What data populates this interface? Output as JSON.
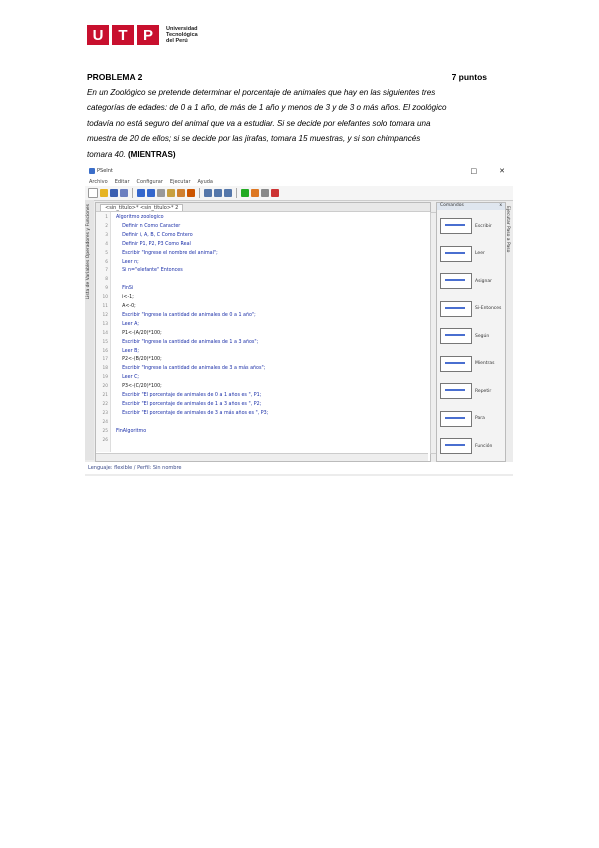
{
  "logo": {
    "letters": [
      "U",
      "T",
      "P"
    ],
    "text": [
      "Universidad",
      "Tecnológica",
      "del Perú"
    ],
    "color": "#c8102e"
  },
  "problem": {
    "title": "PROBLEMA 2",
    "points": "7 puntos"
  },
  "statement": {
    "lines": [
      "En un Zoológico se pretende determinar el porcentaje de animales que hay en las siguientes tres",
      "categorías de edades: de 0 a 1 año, de más de 1 año y menos de 3 y de 3 o más años. El zoológico",
      "todavía no está seguro del animal que va a estudiar. Si se decide por elefantes solo tomara una",
      "muestra de 20 de ellos; si se decide por las jirafas, tomara 15 muestras, y si son chimpancés"
    ],
    "last": "tomara 40.",
    "tag": "(MIENTRAS)"
  },
  "ide": {
    "title": "PSeInt",
    "min": "□",
    "close": "✕",
    "menu": [
      "Archivo",
      "Editar",
      "Configurar",
      "Ejecutar",
      "Ayuda"
    ],
    "tab": "<sin_titulo>*   <sin_titulo>* 2",
    "left_tab": "Lista de Variables     Operadores y Funciones",
    "right_tab": "Ejecutar Paso a Paso",
    "commands_header": "Comandos",
    "commands_close": "x",
    "commands": [
      "Escribir",
      "Leer",
      "Asignar",
      "Si-Entonces",
      "Según",
      "Mientras",
      "Repetir",
      "Para",
      "Función"
    ],
    "code": [
      {
        "n": "1",
        "t": "Algoritmo zoologico"
      },
      {
        "n": "2",
        "t": "    Definir n Como Caracter"
      },
      {
        "n": "3",
        "t": "    Definir i, A, B, C Como Entero"
      },
      {
        "n": "4",
        "t": "    Definir P1, P2, P3 Como Real"
      },
      {
        "n": "5",
        "t": "    Escribir \"Ingrese el nombre del animal\";"
      },
      {
        "n": "6",
        "t": "    Leer n;"
      },
      {
        "n": "7",
        "t": "    Si n=\"elefante\" Entonces"
      },
      {
        "n": "8",
        "t": ""
      },
      {
        "n": "9",
        "t": "    FinSi"
      },
      {
        "n": "10",
        "t": "    i<-1;"
      },
      {
        "n": "11",
        "t": "    A<-0;"
      },
      {
        "n": "12",
        "t": "    Escribir \"Ingrese la cantidad de animales de 0 a 1 año\";"
      },
      {
        "n": "13",
        "t": "    Leer A;"
      },
      {
        "n": "14",
        "t": "    P1<-(A/20)*100;"
      },
      {
        "n": "15",
        "t": "    Escribir \"Ingrese la cantidad de animales de 1 a 3 años\";"
      },
      {
        "n": "16",
        "t": "    Leer B;"
      },
      {
        "n": "17",
        "t": "    P2<-(B/20)*100;"
      },
      {
        "n": "18",
        "t": "    Escribir \"Ingrese la cantidad de animales de 3 a más años\";"
      },
      {
        "n": "19",
        "t": "    Leer C;"
      },
      {
        "n": "20",
        "t": "    P3<-(C/20)*100;"
      },
      {
        "n": "21",
        "t": "    Escribir \"El porcentaje de animales de 0 a 1 años es \", P1;"
      },
      {
        "n": "22",
        "t": "    Escribir \"El porcentaje de animales de 1 a 3 años es \", P2;"
      },
      {
        "n": "23",
        "t": "    Escribir \"El porcentaje de animales de 3 a más años es \", P3;"
      },
      {
        "n": "24",
        "t": ""
      },
      {
        "n": "25",
        "t": "FinAlgoritmo"
      },
      {
        "n": "26",
        "t": ""
      }
    ],
    "status": "Lenguaje: flexible / Perfil: Sin nombre"
  }
}
